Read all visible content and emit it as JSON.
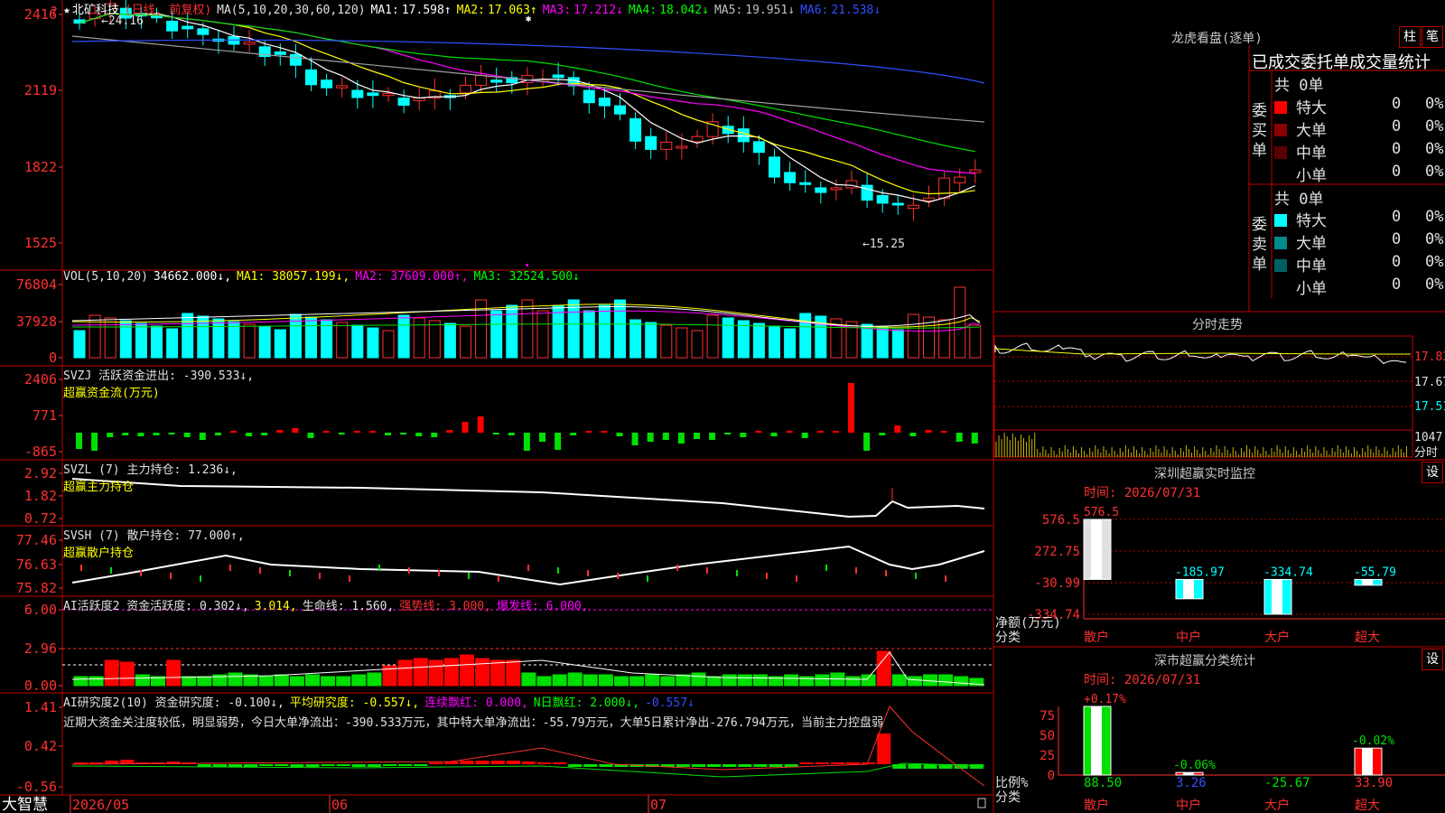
{
  "app": {
    "name": "大智慧",
    "help_icon": "help-icon"
  },
  "colors": {
    "up": "#ff3030",
    "down": "#00ffff",
    "green": "#00e000",
    "grid": "#8b0000",
    "axis": "#ff3030"
  },
  "main": {
    "star": "★",
    "stock": "北矿科技",
    "period": "(日线, 前复权)",
    "ma_label": "MA(5,10,20,30,60,120)",
    "ma": [
      {
        "label": "MA1:",
        "value": "17.598↑",
        "color": "#ffffff"
      },
      {
        "label": "MA2:",
        "value": "17.063↑",
        "color": "#ffff00"
      },
      {
        "label": "MA3:",
        "value": "17.212↓",
        "color": "#ff00ff"
      },
      {
        "label": "MA4:",
        "value": "18.042↓",
        "color": "#00ff00"
      },
      {
        "label": "MA5:",
        "value": "19.951↓",
        "color": "#c0c0c0"
      },
      {
        "label": "MA6:",
        "value": "21.538↓",
        "color": "#3050ff"
      }
    ],
    "y_ticks": [
      "2416",
      "2119",
      "1822",
      "1525"
    ],
    "high_mark": "24.16",
    "low_mark": "←15.25"
  },
  "vol": {
    "label": "VOL(5,10,20)",
    "values": [
      {
        "text": "34662.000↓,",
        "color": "#ffffff"
      },
      {
        "text": "MA1: 38057.199↓,",
        "color": "#ffff00"
      },
      {
        "text": "MA2: 37609.000↑,",
        "color": "#ff00ff"
      },
      {
        "text": "MA3: 32524.500↓",
        "color": "#00ff00"
      }
    ],
    "y_ticks": [
      "76804",
      "37928",
      "0"
    ]
  },
  "svzj": {
    "line1": "SVZJ  活跃资金进出: -390.533↓,",
    "line2": "超赢资金流(万元)",
    "y_ticks": [
      "2406",
      "771",
      "-865"
    ]
  },
  "svzl": {
    "line1": "SVZL (7) 主力持仓: 1.236↓,",
    "line2": "超赢主力持仓",
    "y_ticks": [
      "2.92",
      "1.82",
      "0.72"
    ]
  },
  "svsh": {
    "line1": "SVSH (7) 散户持仓: 77.000↑,",
    "line2": "超赢散户持仓",
    "y_ticks": [
      "77.46",
      "76.63",
      "75.82"
    ]
  },
  "ai_active": {
    "parts": [
      {
        "text": "AI活跃度2 资金活跃度: 0.302↓,",
        "color": "#e0e0e0"
      },
      {
        "text": "3.014,",
        "color": "#ffff00"
      },
      {
        "text": "生命线: 1.560,",
        "color": "#e0e0e0"
      },
      {
        "text": "强势线: 3.000,",
        "color": "#ff3030"
      },
      {
        "text": "爆发线: 6.000,",
        "color": "#ff00ff"
      }
    ],
    "y_ticks": [
      "6.00",
      "2.96",
      "0.00"
    ]
  },
  "ai_research": {
    "parts": [
      {
        "text": "AI研究度2(10) 资金研究度: -0.100↓,",
        "color": "#e0e0e0"
      },
      {
        "text": "平均研究度: -0.557↓,",
        "color": "#ffff00"
      },
      {
        "text": "连续飘红: 0.000,",
        "color": "#ff00ff"
      },
      {
        "text": "N日飘红: 2.000↓,",
        "color": "#00ff00"
      },
      {
        "text": "-0.557↓",
        "color": "#3050ff"
      }
    ],
    "comment": "近期大资金关注度较低，明显弱势，今日大单净流出：-390.533万元，其中特大单净流出：-55.79万元，大单5日累计净出-276.794万元，当前主力控盘弱",
    "y_ticks": [
      "1.41",
      "0.42",
      "-0.56"
    ]
  },
  "x_axis": {
    "labels": [
      "2026/05",
      "06",
      "07"
    ]
  },
  "dragon": {
    "title": "龙虎看盘(逐单)",
    "btn_bar": "柱",
    "btn_order": "笔",
    "header": "已成交委托单成交量统计",
    "buy_side": "委买单",
    "sell_side": "委卖单",
    "buy_total": "共 0单",
    "sell_total": "共 0单",
    "buy_rows": [
      {
        "name": "特大",
        "count": "0",
        "pct": "0%",
        "color": "#ff0000"
      },
      {
        "name": "大单",
        "count": "0",
        "pct": "0%",
        "color": "#8b0000"
      },
      {
        "name": "中单",
        "count": "0",
        "pct": "0%",
        "color": "#5a0000"
      },
      {
        "name": "小单",
        "count": "0",
        "pct": "0%",
        "color": "#000000"
      }
    ],
    "sell_rows": [
      {
        "name": "特大",
        "count": "0",
        "pct": "0%",
        "color": "#00ffff"
      },
      {
        "name": "大单",
        "count": "0",
        "pct": "0%",
        "color": "#008b8b"
      },
      {
        "name": "中单",
        "count": "0",
        "pct": "0%",
        "color": "#006060"
      },
      {
        "name": "小单",
        "count": "0",
        "pct": "0%",
        "color": "#000000"
      }
    ]
  },
  "intraday": {
    "title": "分时走势",
    "y_labels": [
      {
        "text": "17.83",
        "color": "#ff3030"
      },
      {
        "text": "17.67",
        "color": "#e0e0e0"
      },
      {
        "text": "17.51",
        "color": "#00ffff"
      },
      {
        "text": "1047",
        "color": "#e0e0e0"
      }
    ],
    "unit": "分时"
  },
  "sz_monitor": {
    "title": "深圳超赢实时监控",
    "btn": "设",
    "time": "时间: 2026/07/31",
    "y_ticks": [
      "576.5",
      "272.75",
      "-30.99",
      "-334.74"
    ],
    "ylabel": "净额(万元)",
    "xlabel": "分类",
    "bars": [
      {
        "cat": "散户",
        "value": 576.5,
        "label": "576.5"
      },
      {
        "cat": "中户",
        "value": -185.97,
        "label": "-185.97"
      },
      {
        "cat": "大户",
        "value": -334.74,
        "label": "-334.74"
      },
      {
        "cat": "超大",
        "value": -55.79,
        "label": "-55.79"
      }
    ]
  },
  "sz_class": {
    "title": "深市超赢分类统计",
    "btn": "设",
    "time": "时间: 2026/07/31",
    "y_ticks": [
      "75",
      "50",
      "25",
      "0"
    ],
    "ylabel": "比例%",
    "xlabel": "分类",
    "bars": [
      {
        "cat": "散户",
        "value": 88.5,
        "label": "88.50",
        "top": "+0.17%"
      },
      {
        "cat": "中户",
        "value": 3.26,
        "label": "3.26",
        "top": "-0.06%"
      },
      {
        "cat": "大户",
        "value": -25.67,
        "label": "-25.67",
        "top": ""
      },
      {
        "cat": "超大",
        "value": 33.9,
        "label": "33.90",
        "top": "-0.02%"
      }
    ]
  }
}
